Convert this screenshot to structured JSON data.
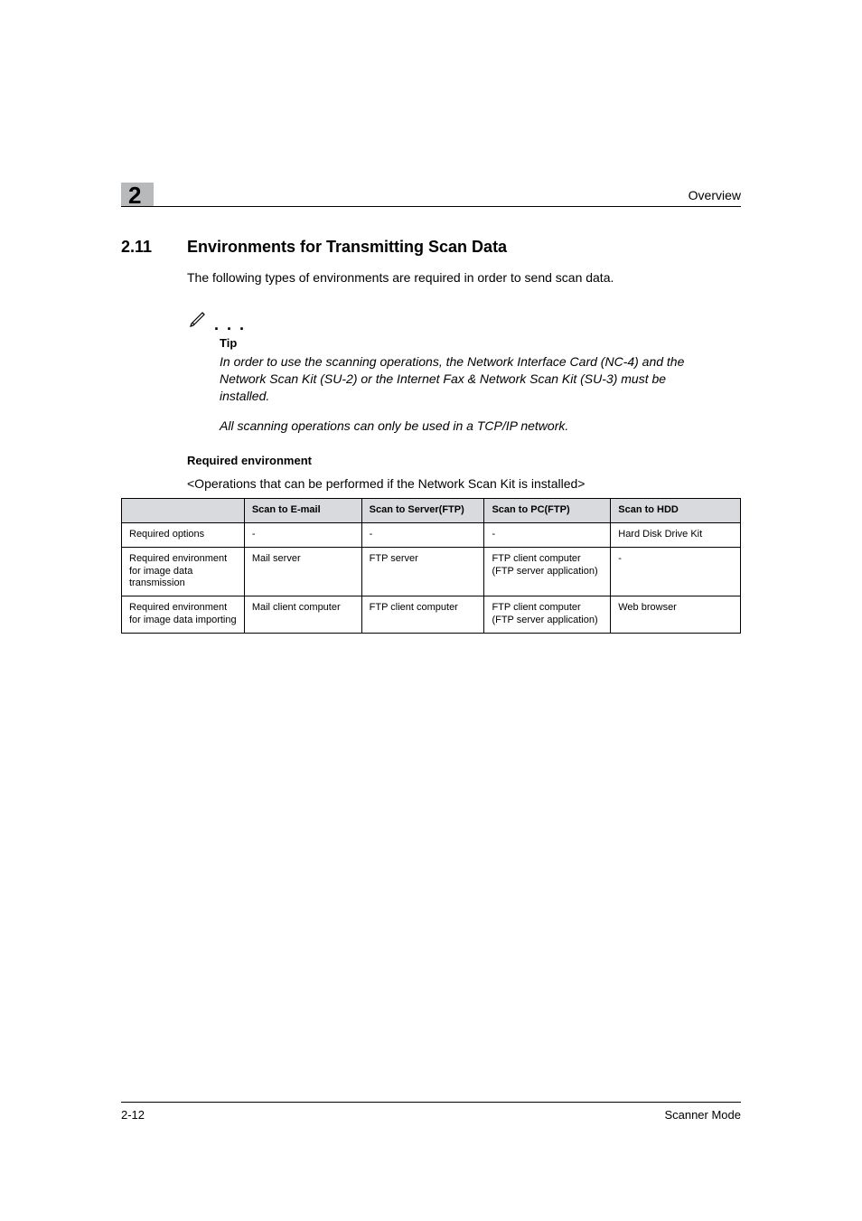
{
  "header": {
    "chapter_num": "2",
    "overview": "Overview"
  },
  "section": {
    "number": "2.11",
    "title": "Environments for Transmitting Scan Data",
    "intro": "The following types of environments are required in order to send scan data."
  },
  "note": {
    "dots": ". . .",
    "tip_label": "Tip",
    "tip_body_1": "In order to use the scanning operations, the Network Interface Card (NC-4) and the Network Scan Kit (SU-2) or the Internet Fax & Network Scan Kit (SU-3) must be installed.",
    "tip_body_2": "All scanning operations can only be used in a TCP/IP network."
  },
  "required_env": {
    "heading": "Required environment",
    "caption": "<Operations that can be performed if the Network Scan Kit is installed>"
  },
  "table": {
    "headers": {
      "c0": "",
      "c1": "Scan to E-mail",
      "c2": "Scan to Server(FTP)",
      "c3": "Scan to PC(FTP)",
      "c4": "Scan to HDD"
    },
    "rows": [
      {
        "c0": "Required options",
        "c1": "-",
        "c2": "-",
        "c3": "-",
        "c4": "Hard Disk Drive Kit"
      },
      {
        "c0": "Required environment for image data transmission",
        "c1": "Mail server",
        "c2": "FTP server",
        "c3": "FTP client computer\n(FTP server application)",
        "c4": "-"
      },
      {
        "c0": "Required environment for image data importing",
        "c1": "Mail client computer",
        "c2": "FTP client computer",
        "c3": "FTP client computer\n(FTP server application)",
        "c4": "Web browser"
      }
    ]
  },
  "footer": {
    "left": "2-12",
    "right": "Scanner Mode"
  }
}
